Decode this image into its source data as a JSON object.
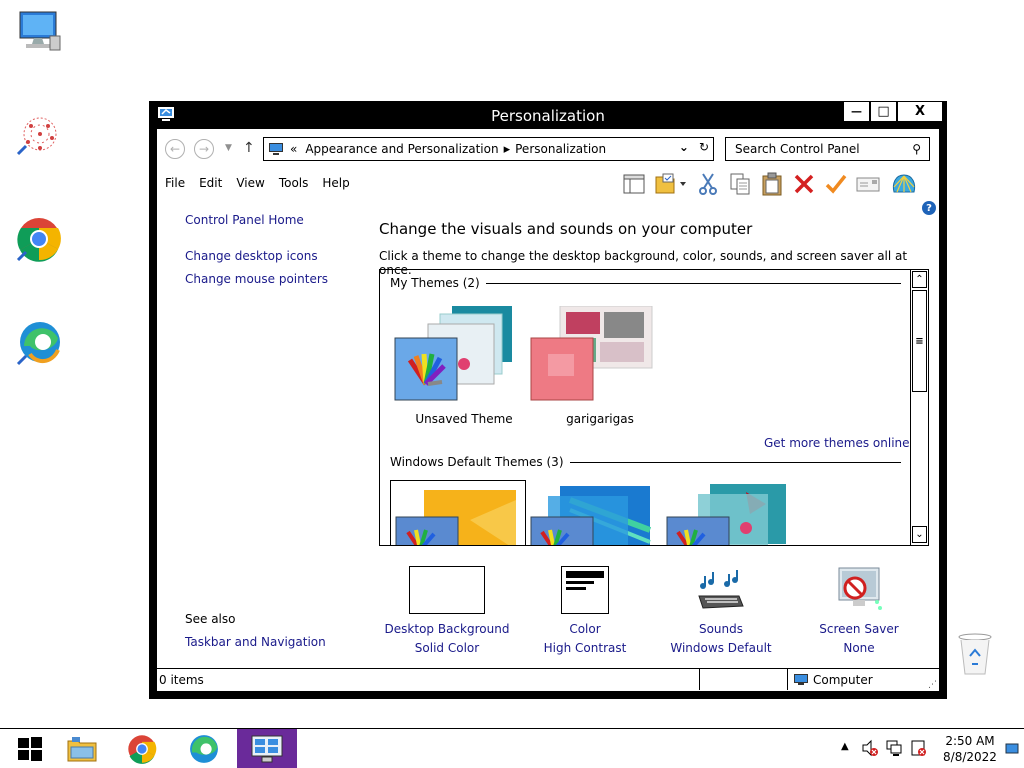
{
  "window": {
    "title": "Personalization",
    "minimize": "—",
    "maximize": "□",
    "close": "X"
  },
  "address": {
    "chevrons": "«",
    "crumb1": "Appearance and Personalization",
    "crumb2": "Personalization",
    "search_placeholder": "Search Control Panel"
  },
  "menu": [
    "File",
    "Edit",
    "View",
    "Tools",
    "Help"
  ],
  "left_pane": {
    "home": "Control Panel Home",
    "links": [
      "Change desktop icons",
      "Change mouse pointers"
    ],
    "see_also": "See also",
    "see_also_links": [
      "Taskbar and Navigation"
    ]
  },
  "main": {
    "heading": "Change the visuals and sounds on your computer",
    "subtext": "Click a theme to change the desktop background, color, sounds, and screen saver all at once.",
    "my_themes_label": "My Themes (2)",
    "my_themes": [
      "Unsaved Theme",
      "garigarigas"
    ],
    "get_more": "Get more themes online",
    "default_themes_label": "Windows Default Themes (3)"
  },
  "settings": [
    {
      "label": "Desktop Background",
      "value": "Solid Color"
    },
    {
      "label": "Color",
      "value": "High Contrast"
    },
    {
      "label": "Sounds",
      "value": "Windows Default"
    },
    {
      "label": "Screen Saver",
      "value": "None"
    }
  ],
  "status": {
    "items": "0 items",
    "location": "Computer"
  },
  "taskbar": {
    "time": "2:50 AM",
    "date": "8/8/2022"
  },
  "colors": {
    "link": "#1a1a8a",
    "active_task": "#6a2a9a",
    "help": "#1e63b8"
  }
}
